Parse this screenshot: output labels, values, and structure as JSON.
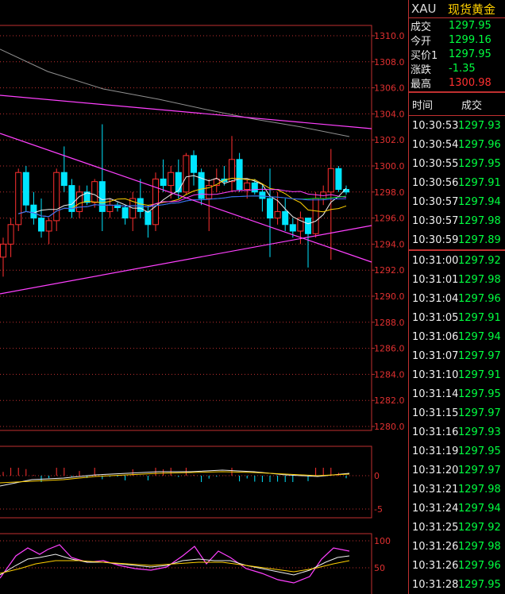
{
  "header": {
    "symbol": "XAU",
    "name": "现货黄金"
  },
  "quote": [
    {
      "label": "成交",
      "value": "1297.95",
      "color": "green"
    },
    {
      "label": "今开",
      "value": "1299.16",
      "color": "green"
    },
    {
      "label": "买价1",
      "value": "1297.95",
      "color": "green"
    },
    {
      "label": "涨跌",
      "value": "-1.35",
      "color": "green"
    },
    {
      "label": "最高",
      "value": "1300.98",
      "color": "red"
    }
  ],
  "ticks_header": {
    "time": "时间",
    "price": "成交"
  },
  "ticks": [
    {
      "time": "10:30:53",
      "price": "1297.93"
    },
    {
      "time": "10:30:54",
      "price": "1297.96"
    },
    {
      "time": "10:30:55",
      "price": "1297.95"
    },
    {
      "time": "10:30:56",
      "price": "1297.91"
    },
    {
      "time": "10:30:57",
      "price": "1297.94"
    },
    {
      "time": "10:30:57",
      "price": "1297.98"
    },
    {
      "time": "10:30:59",
      "price": "1297.89"
    },
    {
      "time": "10:31:00",
      "price": "1297.92"
    },
    {
      "time": "10:31:01",
      "price": "1297.98"
    },
    {
      "time": "10:31:04",
      "price": "1297.96"
    },
    {
      "time": "10:31:05",
      "price": "1297.91"
    },
    {
      "time": "10:31:06",
      "price": "1297.94"
    },
    {
      "time": "10:31:07",
      "price": "1297.97"
    },
    {
      "time": "10:31:10",
      "price": "1297.91"
    },
    {
      "time": "10:31:14",
      "price": "1297.95"
    },
    {
      "time": "10:31:15",
      "price": "1297.97"
    },
    {
      "time": "10:31:16",
      "price": "1297.93"
    },
    {
      "time": "10:31:19",
      "price": "1297.95"
    },
    {
      "time": "10:31:20",
      "price": "1297.97"
    },
    {
      "time": "10:31:21",
      "price": "1297.98"
    },
    {
      "time": "10:31:24",
      "price": "1297.94"
    },
    {
      "time": "10:31:25",
      "price": "1297.92"
    },
    {
      "time": "10:31:26",
      "price": "1297.98"
    },
    {
      "time": "10:31:26",
      "price": "1297.96"
    },
    {
      "time": "10:31:28",
      "price": "1297.95"
    }
  ],
  "price_axis": [
    "1310.0",
    "1308.0",
    "1306.0",
    "1304.0",
    "1302.0",
    "1300.0",
    "1298.0",
    "1296.0",
    "1294.0",
    "1292.0",
    "1290.0",
    "1288.0",
    "1286.0",
    "1284.0",
    "1282.0",
    "1280.0"
  ],
  "macd_axis": [
    "0",
    "-5"
  ],
  "kdj_axis": [
    "100",
    "50"
  ],
  "colors": {
    "up": "#ff3030",
    "down": "#00e5ff",
    "grid": "#c03030",
    "green": "#00ff40",
    "yellow": "#ffd000"
  },
  "chart_data": {
    "type": "candlestick",
    "ylim": [
      1280,
      1310
    ],
    "candles": [
      {
        "o": 1293.0,
        "h": 1294.5,
        "l": 1291.5,
        "c": 1294.0
      },
      {
        "o": 1294.0,
        "h": 1296.0,
        "l": 1293.0,
        "c": 1295.5
      },
      {
        "o": 1295.5,
        "h": 1299.8,
        "l": 1295.0,
        "c": 1299.5
      },
      {
        "o": 1299.5,
        "h": 1300.0,
        "l": 1296.5,
        "c": 1297.0
      },
      {
        "o": 1297.0,
        "h": 1298.0,
        "l": 1295.5,
        "c": 1296.0
      },
      {
        "o": 1296.0,
        "h": 1297.5,
        "l": 1294.5,
        "c": 1295.0
      },
      {
        "o": 1295.0,
        "h": 1296.0,
        "l": 1294.0,
        "c": 1295.8
      },
      {
        "o": 1295.8,
        "h": 1299.8,
        "l": 1295.0,
        "c": 1299.5
      },
      {
        "o": 1299.5,
        "h": 1301.5,
        "l": 1298.0,
        "c": 1298.5
      },
      {
        "o": 1298.5,
        "h": 1299.0,
        "l": 1296.0,
        "c": 1296.5
      },
      {
        "o": 1296.5,
        "h": 1298.5,
        "l": 1296.0,
        "c": 1298.0
      },
      {
        "o": 1298.0,
        "h": 1298.5,
        "l": 1297.0,
        "c": 1297.2
      },
      {
        "o": 1297.2,
        "h": 1299.0,
        "l": 1296.8,
        "c": 1298.8
      },
      {
        "o": 1298.8,
        "h": 1303.2,
        "l": 1295.0,
        "c": 1296.5
      },
      {
        "o": 1296.5,
        "h": 1297.5,
        "l": 1296.0,
        "c": 1297.0
      },
      {
        "o": 1297.0,
        "h": 1297.2,
        "l": 1296.5,
        "c": 1296.8
      },
      {
        "o": 1296.8,
        "h": 1297.0,
        "l": 1295.5,
        "c": 1296.0
      },
      {
        "o": 1296.0,
        "h": 1298.0,
        "l": 1295.0,
        "c": 1297.5
      },
      {
        "o": 1297.5,
        "h": 1299.0,
        "l": 1296.0,
        "c": 1296.5
      },
      {
        "o": 1296.5,
        "h": 1297.0,
        "l": 1294.5,
        "c": 1295.5
      },
      {
        "o": 1295.5,
        "h": 1299.5,
        "l": 1295.0,
        "c": 1299.0
      },
      {
        "o": 1299.0,
        "h": 1300.5,
        "l": 1298.0,
        "c": 1298.5
      },
      {
        "o": 1298.5,
        "h": 1300.0,
        "l": 1297.5,
        "c": 1299.5
      },
      {
        "o": 1299.5,
        "h": 1300.5,
        "l": 1297.5,
        "c": 1298.0
      },
      {
        "o": 1298.0,
        "h": 1301.0,
        "l": 1297.8,
        "c": 1300.8
      },
      {
        "o": 1300.8,
        "h": 1301.2,
        "l": 1298.5,
        "c": 1299.5
      },
      {
        "o": 1299.5,
        "h": 1299.8,
        "l": 1297.0,
        "c": 1297.5
      },
      {
        "o": 1297.5,
        "h": 1299.0,
        "l": 1295.0,
        "c": 1298.5
      },
      {
        "o": 1298.5,
        "h": 1299.8,
        "l": 1298.0,
        "c": 1299.0
      },
      {
        "o": 1299.0,
        "h": 1300.0,
        "l": 1298.5,
        "c": 1298.8
      },
      {
        "o": 1298.8,
        "h": 1302.3,
        "l": 1298.0,
        "c": 1300.5
      },
      {
        "o": 1300.5,
        "h": 1301.0,
        "l": 1298.0,
        "c": 1298.2
      },
      {
        "o": 1298.2,
        "h": 1299.0,
        "l": 1297.5,
        "c": 1298.7
      },
      {
        "o": 1298.7,
        "h": 1299.0,
        "l": 1297.8,
        "c": 1298.0
      },
      {
        "o": 1298.0,
        "h": 1298.5,
        "l": 1296.5,
        "c": 1297.5
      },
      {
        "o": 1297.5,
        "h": 1299.8,
        "l": 1293.0,
        "c": 1296.0
      },
      {
        "o": 1296.0,
        "h": 1298.0,
        "l": 1295.5,
        "c": 1296.5
      },
      {
        "o": 1296.5,
        "h": 1297.5,
        "l": 1295.0,
        "c": 1295.5
      },
      {
        "o": 1295.5,
        "h": 1296.0,
        "l": 1294.5,
        "c": 1295.0
      },
      {
        "o": 1295.0,
        "h": 1296.5,
        "l": 1294.0,
        "c": 1296.0
      },
      {
        "o": 1296.0,
        "h": 1296.0,
        "l": 1292.2,
        "c": 1294.8
      },
      {
        "o": 1294.8,
        "h": 1298.0,
        "l": 1294.5,
        "c": 1297.5
      },
      {
        "o": 1297.5,
        "h": 1298.5,
        "l": 1297.0,
        "c": 1298.0
      },
      {
        "o": 1298.0,
        "h": 1301.3,
        "l": 1292.8,
        "c": 1299.8
      },
      {
        "o": 1299.8,
        "h": 1300.0,
        "l": 1298.0,
        "c": 1298.2
      },
      {
        "o": 1298.2,
        "h": 1298.5,
        "l": 1297.8,
        "c": 1298.0
      }
    ],
    "macd_ylim": [
      -5,
      1.5
    ],
    "kdj_ylim": [
      30,
      110
    ]
  }
}
